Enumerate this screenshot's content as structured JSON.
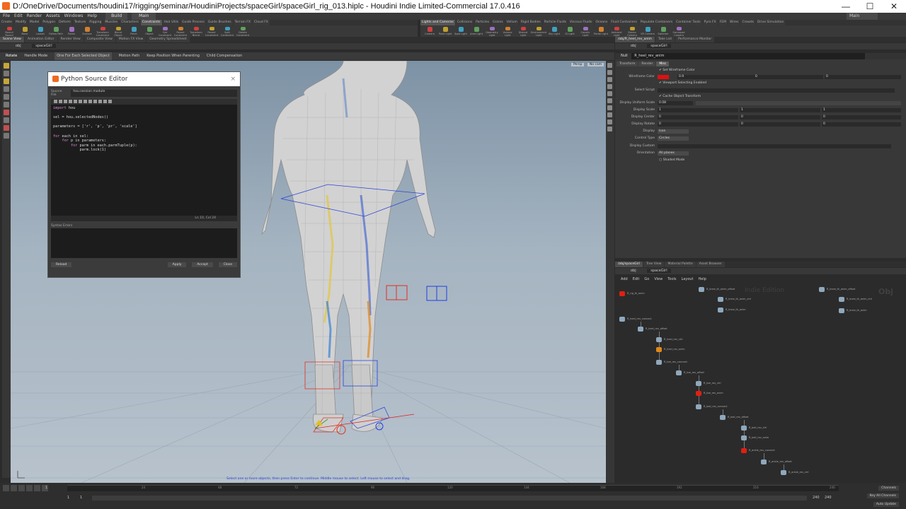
{
  "window": {
    "title": "D:/OneDrive/Documents/houdini17/rigging/seminar/HoudiniProjects/spaceGirl/spaceGirl_rig_013.hiplc - Houdini Indie Limited-Commercial 17.0.416",
    "minimize": "—",
    "maximize": "☐",
    "close": "✕"
  },
  "menu": [
    "File",
    "Edit",
    "Render",
    "Assets",
    "Windows",
    "Help"
  ],
  "desktop": {
    "label": "Build",
    "name": "Main",
    "user": "Main"
  },
  "shelf_tabs_left": [
    "Create",
    "Modify",
    "Model",
    "Polygon",
    "Deform",
    "Texture",
    "Rigging",
    "Muscles",
    "Characters",
    "Constraints",
    "Hair Utils",
    "Guide Process",
    "Guide Brushes",
    "Terrain FX",
    "Cloud FX"
  ],
  "shelf_tabs_right": [
    "Lights and Cameras",
    "Collisions",
    "Particles",
    "Grains",
    "Vellum",
    "Rigid Bodies",
    "Particle Fluids",
    "Viscous Fluids",
    "Oceans",
    "Fluid Containers",
    "Populate Containers",
    "Container Tools",
    "Pyro FX",
    "FEM",
    "Wires",
    "Crowds",
    "Drive Simulation"
  ],
  "shelf_tools_left": [
    "Bound Bound",
    "Bone",
    "Lookat",
    "Follow Path",
    "Points",
    "Surface",
    "Transform Constraint",
    "Blend Object",
    "Fetch",
    "Object",
    "Get Constraint",
    "Parent Constraint",
    "Transform Blend",
    "Parent Constraint",
    "Split Constraint",
    "Delete Constraint"
  ],
  "shelf_tools_right": [
    "Camera",
    "Point Light",
    "Spot Light",
    "Area Light",
    "Geometry Light",
    "Volume Light",
    "Distant Light",
    "Environment Light",
    "Sky Light",
    "GI Light",
    "Caustic Light",
    "Portal Light",
    "Ambient Light",
    "Stereo Camera",
    "VR Camera",
    "Switcher",
    "Gamepad Camera"
  ],
  "viewer_tabs": [
    "Scene View",
    "Animation Editor",
    "Render View",
    "Composite View",
    "Motion FX View",
    "Geometry Spreadsheet"
  ],
  "viewer_path": {
    "obj": "obj",
    "node": "spaceGirl"
  },
  "opbar": {
    "tool": "Rotate",
    "mode": "Handle Mode",
    "per_object": "One For Each Selected Object",
    "motion_path": "Motion Path",
    "keep_position": "Keep Position When Parenting",
    "child_comp": "Child Compensation"
  },
  "viewport": {
    "persp": "Persp",
    "nocam": "No cam",
    "status": "Select one or more objects, then press Enter to continue. Middle mouse to select. Left mouse to select and drag."
  },
  "editor": {
    "title": "Python Source Editor",
    "close": "×",
    "source_label": "Source File",
    "source_value": "hou.session module",
    "code": [
      {
        "kw": "import",
        "rest": " hou"
      },
      {
        "kw": "",
        "rest": ""
      },
      {
        "kw": "",
        "rest": "sel = hou.selectedNodes()"
      },
      {
        "kw": "",
        "rest": ""
      },
      {
        "kw": "",
        "rest": "parameters = ['r', 'p', 'pr', 'scale']"
      },
      {
        "kw": "",
        "rest": ""
      },
      {
        "kw": "for",
        "rest": " each in sel:"
      },
      {
        "kw": "    for",
        "rest": " p in parameters:"
      },
      {
        "kw": "        for",
        "rest": " parm in each.parmTuple(p):"
      },
      {
        "kw": "",
        "rest": "            parm.lock(1)"
      }
    ],
    "cursor": "Ln 10, Col 24",
    "syntax_label": "Syntax Errors",
    "reload": "Reload",
    "apply": "Apply",
    "accept": "Accept",
    "close_btn": "Close"
  },
  "timeline": {
    "ticks": [
      "24",
      "48",
      "72",
      "96",
      "120",
      "144",
      "168",
      "192",
      "216",
      "240"
    ],
    "start": "1",
    "current": "1",
    "end_a": "240",
    "end_b": "240",
    "channels_label": "Channels",
    "keys_label": "Key All Channels",
    "auto_update": "Auto Update"
  },
  "param_tabs": [
    "/obj/R_heel_rev_anim",
    "Take List",
    "Performance Monitor"
  ],
  "param": {
    "node_type": "Null",
    "node_name": "R_heel_rev_anim",
    "tabs": [
      "Transform",
      "Render",
      "Misc"
    ],
    "set_wire_color": "Set Wireframe Color",
    "wire_color_label": "Wireframe Color",
    "wire_color": "#e01010",
    "wire_values": [
      "0.9",
      "0",
      "0"
    ],
    "viewport_select": "Viewport Selecting Enabled",
    "select_script": "Select Script",
    "cache_transform": "Cache Object Transform",
    "uniform_scale_label": "Display Uniform Scale",
    "uniform_scale": "0.08",
    "display_scale": "Display Scale",
    "scale_vals": [
      "1",
      "1",
      "1"
    ],
    "display_center": "Display Center",
    "center_vals": [
      "0",
      "0",
      "0"
    ],
    "display_rotate": "Display Rotate",
    "rotate_vals": [
      "0",
      "0",
      "0"
    ],
    "display": "Display",
    "display_val": "Icon",
    "control_type": "Control Type",
    "control_val": "Circles",
    "display_custom": "Display Custom",
    "orientation": "Orientation",
    "orientation_val": "All planes",
    "shaded_mode": "Shaded Mode"
  },
  "net_tabs": [
    "/obj/spaceGirl",
    "Tree View",
    "Material Palette",
    "Asset Browser"
  ],
  "net_path": {
    "obj": "obj",
    "node": "spaceGirl"
  },
  "net_menu": [
    "Add",
    "Edit",
    "Go",
    "View",
    "Tools",
    "Layout",
    "Help"
  ],
  "net_watermark": "Indie Edition",
  "net_watermark2": "Obj",
  "nodes": [
    "R_rig_th_anim",
    "R_knee_th_anim_offset",
    "R_knee_th_anim_ctrl",
    "R_knee_th_anim",
    "R_heel_rev_connect",
    "R_heel_rev_offset",
    "R_heel_rev_ctrl",
    "R_heel_rev_anim",
    "R_toe_rev_connect",
    "R_toe_rev_offset",
    "R_toe_rev_ctrl",
    "R_toe_rev_anim",
    "R_ball_rev_connect",
    "R_ball_rev_offset",
    "R_ball_rev_ctrl",
    "R_ball_rev_anim",
    "R_ankle_rev_connect",
    "R_ankle_rev_offset",
    "R_ankle_rev_ctrl",
    "R_knee_th_anim_offset",
    "R_knee_th_anim_ctrl",
    "R_knee_th_anim"
  ]
}
